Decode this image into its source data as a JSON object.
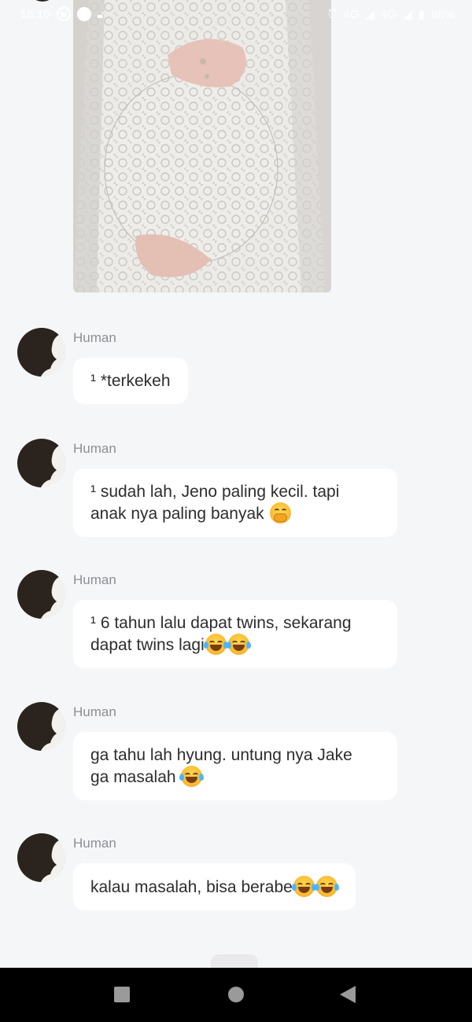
{
  "status_bar": {
    "time": "18.10",
    "battery": "88%",
    "network_1": "4G",
    "network_2": "4G",
    "icons": [
      "screen-record-icon",
      "play-icon",
      "lock-icon",
      "alarm-icon",
      "signal-icon",
      "battery-icon"
    ]
  },
  "photo": {
    "description_icon": "image"
  },
  "messages": [
    {
      "sender": "Human",
      "text": "¹ *terkekeh",
      "emojis": []
    },
    {
      "sender": "Human",
      "text_line1": "¹ sudah lah, Jeno paling kecil. tapi",
      "text_line2": "anak nya paling banyak",
      "emojis": [
        "face-with-hand-over-mouth"
      ]
    },
    {
      "sender": "Human",
      "text_line1": "¹ 6 tahun lalu dapat twins, sekarang",
      "text_line2": "dapat twins lagi",
      "emojis": [
        "face-with-tears-of-joy",
        "face-with-tears-of-joy"
      ]
    },
    {
      "sender": "Human",
      "text_line1": "ga tahu lah hyung. untung nya Jake",
      "text_line2": "ga masalah",
      "emojis": [
        "face-with-tears-of-joy"
      ]
    },
    {
      "sender": "Human",
      "text": "kalau masalah, bisa berabe",
      "emojis": [
        "face-with-tears-of-joy",
        "face-with-tears-of-joy"
      ]
    }
  ],
  "colors": {
    "background": "#f5f6f8",
    "bubble": "#ffffff",
    "sender_name": "#8e8e93",
    "nav_bar": "#000000"
  }
}
